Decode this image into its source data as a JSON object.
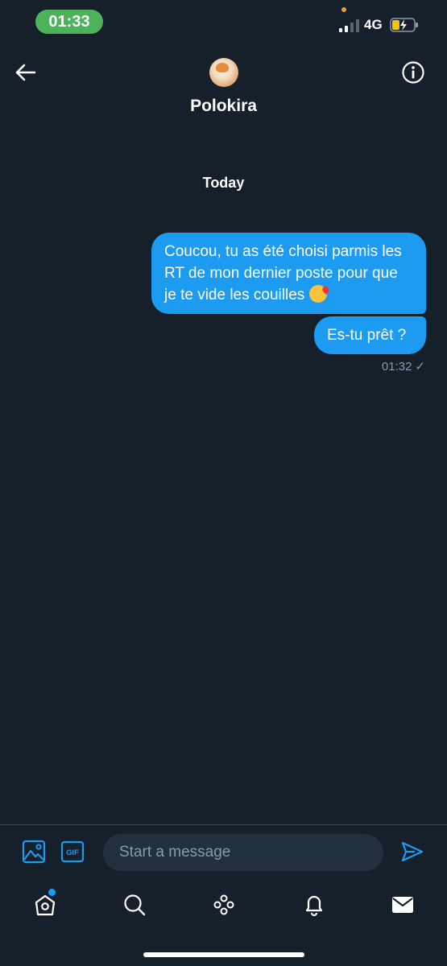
{
  "status_bar": {
    "time": "01:33",
    "network": "4G",
    "icons": [
      "signal-icon",
      "battery-charging-icon"
    ]
  },
  "header": {
    "contact_name": "Polokira",
    "icons": [
      "back-arrow-icon",
      "info-icon",
      "avatar"
    ]
  },
  "conversation": {
    "date_separator": "Today",
    "messages": [
      {
        "text": "Coucou, tu as été choisi parmis les RT de mon dernier poste pour que je te vide les couilles",
        "emoji": "kissing-face-emoji"
      },
      {
        "text": "Es-tu prêt ?"
      }
    ],
    "timestamp": "01:32",
    "status_mark": "✓"
  },
  "composer": {
    "placeholder": "Start a message",
    "icons": [
      "image-icon",
      "gif-icon",
      "send-icon"
    ]
  },
  "tab_bar": {
    "items": [
      "home-icon",
      "search-icon",
      "spaces-icon",
      "notifications-bell-icon",
      "messages-envelope-icon"
    ]
  },
  "colors": {
    "background": "#15202b",
    "accent": "#1d9bf0",
    "muted_text": "#8b98a5",
    "status_pill": "#4cb35a"
  }
}
